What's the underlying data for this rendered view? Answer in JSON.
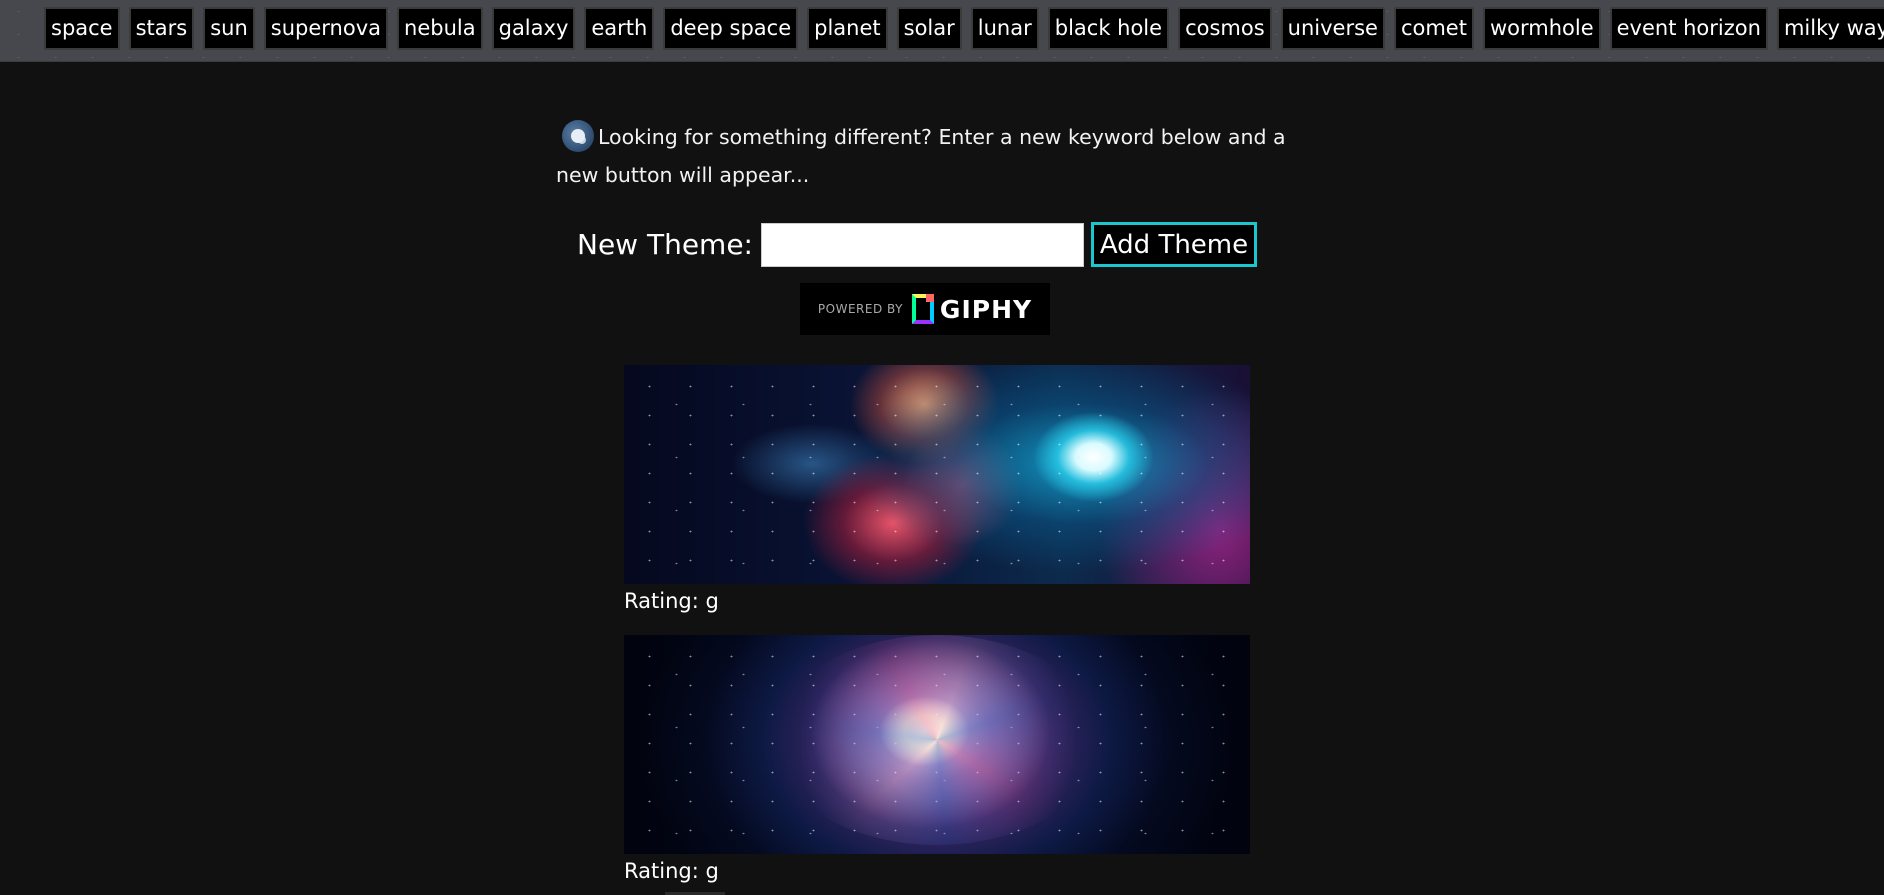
{
  "theme_buttons": [
    "space",
    "stars",
    "sun",
    "supernova",
    "nebula",
    "galaxy",
    "earth",
    "deep space",
    "planet",
    "solar",
    "lunar",
    "black hole",
    "cosmos",
    "universe",
    "comet",
    "wormhole",
    "event horizon",
    "milky way"
  ],
  "intro": {
    "icon": "astronaut-icon",
    "text": "Looking for something different? Enter a new keyword below and a new button will appear..."
  },
  "form": {
    "label": "New Theme:",
    "input_value": "",
    "input_placeholder": "",
    "add_button_label": "Add Theme",
    "accent_color": "#1bc6cf"
  },
  "giphy": {
    "powered_by": "POWERED BY",
    "brand": "GIPHY"
  },
  "gifs": [
    {
      "image": "nebula-image",
      "rating": "Rating: g"
    },
    {
      "image": "galaxy-image",
      "rating": "Rating: g"
    }
  ]
}
